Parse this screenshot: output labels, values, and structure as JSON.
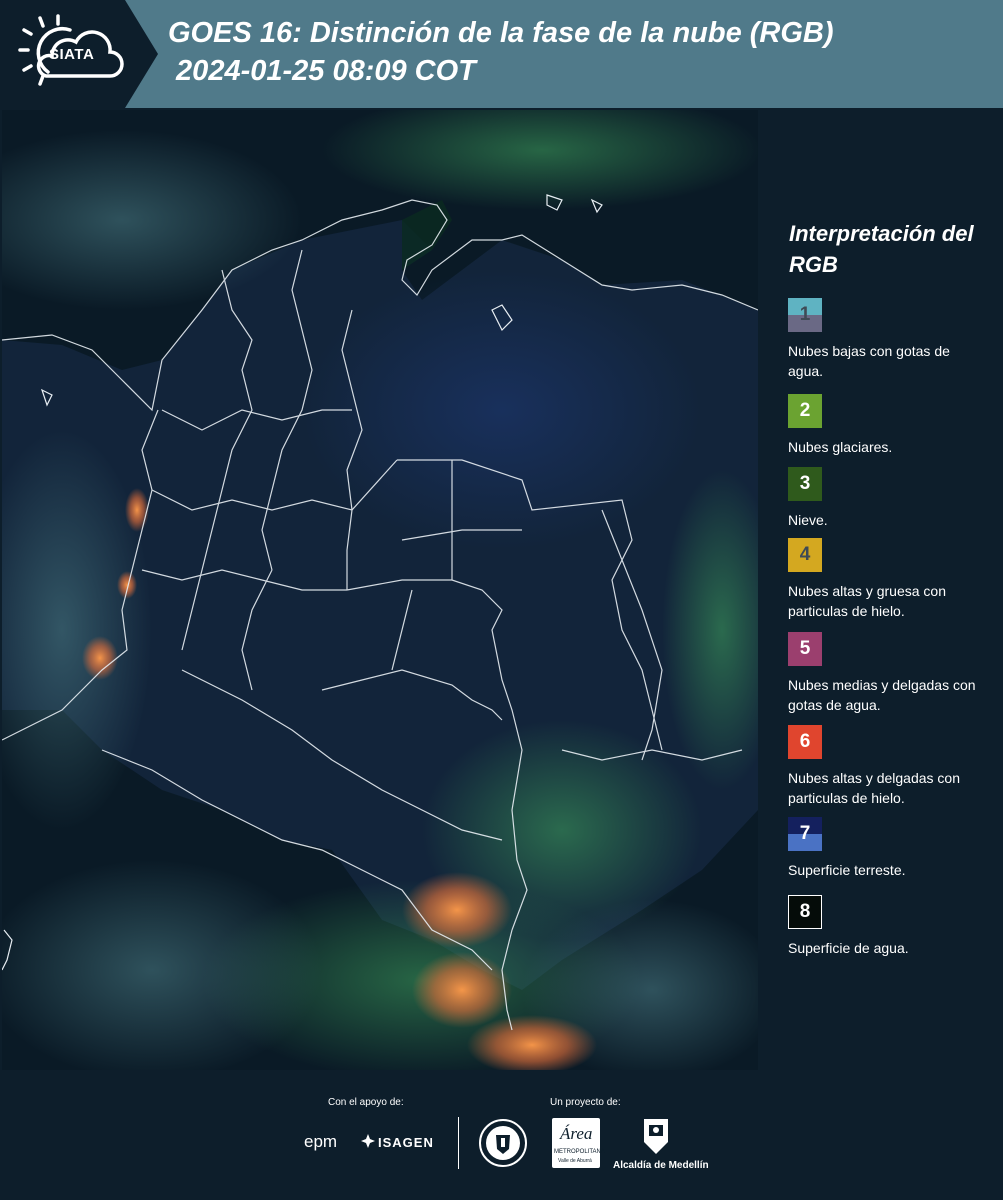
{
  "header": {
    "logo_text": "SIATA",
    "title_line1": "GOES 16: Distinción de la fase de la nube (RGB)",
    "title_line2": " 2024-01-25 08:09 COT"
  },
  "legend": {
    "title": "Interpretación del RGB",
    "items": [
      {
        "number": "1",
        "label": "Nubes bajas con gotas de agua.",
        "color_top": "#5fb3c2",
        "color_bottom": "#6a6985"
      },
      {
        "number": "2",
        "label": "Nubes glaciares.",
        "color": "#6ba331"
      },
      {
        "number": "3",
        "label": "Nieve.",
        "color": "#2f5a1c"
      },
      {
        "number": "4",
        "label": "Nubes altas y gruesa con particulas de hielo.",
        "color": "#d4a820"
      },
      {
        "number": "5",
        "label": "Nubes medias y delgadas con gotas de agua.",
        "color": "#9b3f6e"
      },
      {
        "number": "6",
        "label": "Nubes altas y delgadas con particulas de hielo.",
        "color": "#e0452e"
      },
      {
        "number": "7",
        "label": "Superficie terreste.",
        "color_top": "#14205e",
        "color_bottom": "#4a72c4"
      },
      {
        "number": "8",
        "label": "Superficie de agua.",
        "color": "#050c09"
      }
    ]
  },
  "footer": {
    "support_label": "Con el apoyo de:",
    "project_label": "Un proyecto de:",
    "epm": "epm",
    "isagen": "ISAGEN",
    "area_metro": "Área",
    "area_metro_sub": "METROPOLITANA",
    "area_metro_sub2": "Valle de Aburrá",
    "alcaldia": "Alcaldía de Medellín"
  }
}
